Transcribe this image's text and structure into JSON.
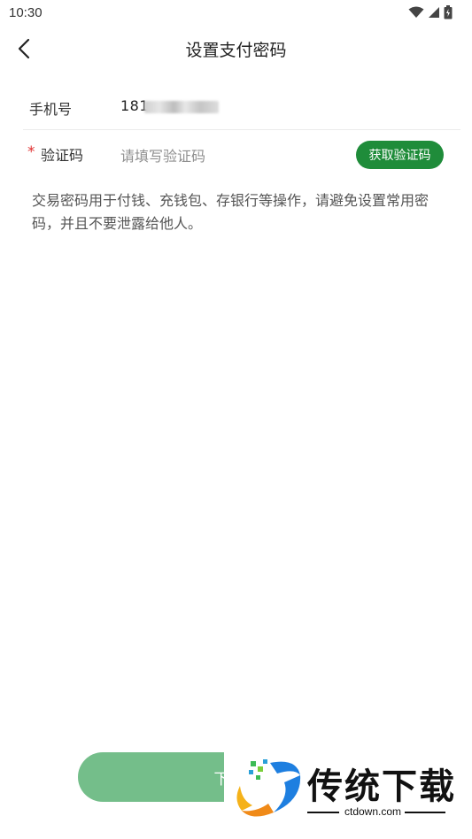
{
  "status_bar": {
    "time": "10:30",
    "icons": [
      "wifi-icon",
      "signal-icon",
      "battery-icon"
    ]
  },
  "header": {
    "title": "设置支付密码",
    "back_icon": "chevron-left-icon"
  },
  "form": {
    "phone_label": "手机号",
    "phone_value": "181",
    "code_label": "验证码",
    "code_required_mark": "*",
    "code_placeholder": "请填写验证码",
    "code_value": "",
    "get_code_label": "获取验证码"
  },
  "hint_text": "交易密码用于付钱、充钱包、存银行等操作，请避免设置常用密码，并且不要泄露给他人。",
  "footer": {
    "next_label": "下一步"
  },
  "watermark": {
    "title": "传统下载",
    "url": "ctdown.com"
  },
  "colors": {
    "primary_green": "#1f8c3a",
    "disabled_green": "#74be8a",
    "required_red": "#e03030"
  }
}
